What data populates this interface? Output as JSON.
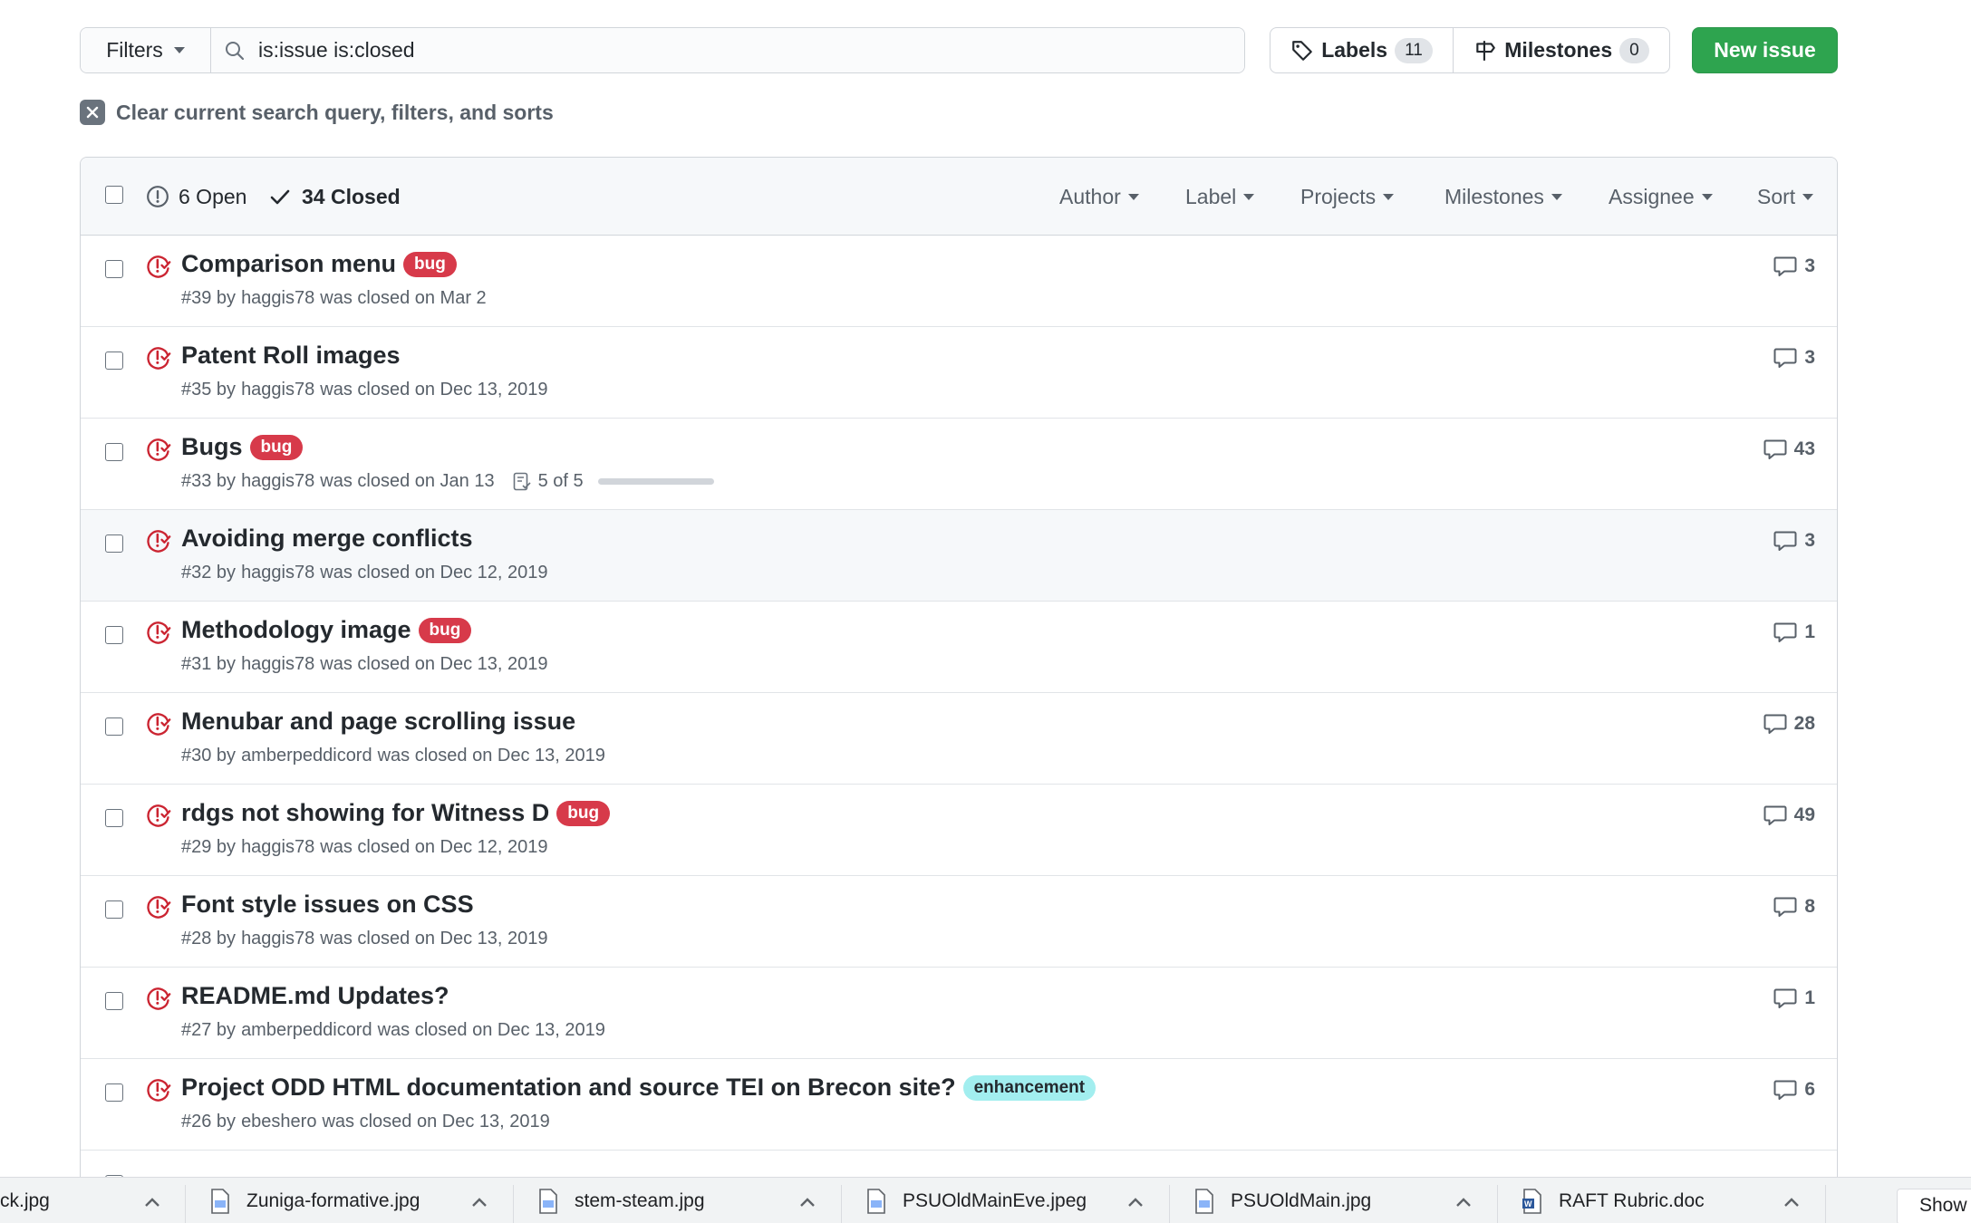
{
  "toolbar": {
    "filters_label": "Filters",
    "search_value": "is:issue is:closed",
    "labels_label": "Labels",
    "labels_count": "11",
    "milestones_label": "Milestones",
    "milestones_count": "0",
    "new_issue_label": "New issue"
  },
  "clear_filters": "Clear current search query, filters, and sorts",
  "header": {
    "open_label": "6 Open",
    "closed_label": "34 Closed",
    "menus": [
      "Author",
      "Label",
      "Projects",
      "Milestones",
      "Assignee",
      "Sort"
    ]
  },
  "issues": [
    {
      "title": "Comparison menu",
      "label": "bug",
      "meta": "#39 by",
      "author": "haggis78",
      "closed": "was closed on Mar 2",
      "comments": "3"
    },
    {
      "title": "Patent Roll images",
      "label": "",
      "meta": "#35 by",
      "author": "haggis78",
      "closed": "was closed on Dec 13, 2019",
      "comments": "3"
    },
    {
      "title": "Bugs",
      "label": "bug",
      "meta": "#33 by",
      "author": "haggis78",
      "closed": "was closed on Jan 13",
      "tasks": "5 of 5",
      "comments": "43"
    },
    {
      "title": "Avoiding merge conflicts",
      "label": "",
      "meta": "#32 by",
      "author": "haggis78",
      "closed": "was closed on Dec 12, 2019",
      "comments": "3"
    },
    {
      "title": "Methodology image",
      "label": "bug",
      "meta": "#31 by",
      "author": "haggis78",
      "closed": "was closed on Dec 13, 2019",
      "comments": "1"
    },
    {
      "title": "Menubar and page scrolling issue",
      "label": "",
      "meta": "#30 by",
      "author": "amberpeddicord",
      "closed": "was closed on Dec 13, 2019",
      "comments": "28"
    },
    {
      "title": "rdgs not showing for Witness D",
      "label": "bug",
      "meta": "#29 by",
      "author": "haggis78",
      "closed": "was closed on Dec 12, 2019",
      "comments": "49"
    },
    {
      "title": "Font style issues on CSS",
      "label": "",
      "meta": "#28 by",
      "author": "haggis78",
      "closed": "was closed on Dec 13, 2019",
      "comments": "8"
    },
    {
      "title": "README.md Updates?",
      "label": "",
      "meta": "#27 by",
      "author": "amberpeddicord",
      "closed": "was closed on Dec 13, 2019",
      "comments": "1"
    },
    {
      "title": "Project ODD HTML documentation and source TEI on Brecon site?",
      "label": "enhancement",
      "meta": "#26 by",
      "author": "ebeshero",
      "closed": "was closed on Dec 13, 2019",
      "comments": "6"
    }
  ],
  "downloads": {
    "items": [
      "ck.jpg",
      "Zuniga-formative.jpg",
      "stem-steam.jpg",
      "PSUOldMainEve.jpeg",
      "PSUOldMain.jpg",
      "RAFT Rubric.doc"
    ],
    "show_all": "Show all"
  },
  "colors": {
    "accent_green": "#2ea44f",
    "closed_red": "#cb2431",
    "bug_label": "#d73a4a",
    "enhancement_label": "#a2eeef"
  }
}
